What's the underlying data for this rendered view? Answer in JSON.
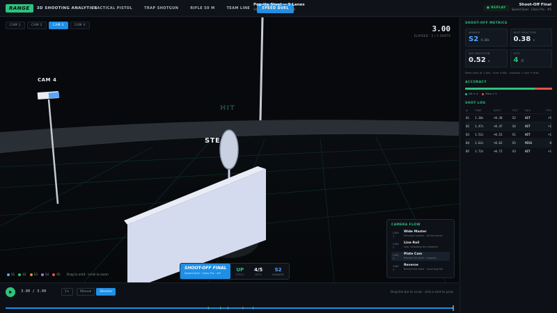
{
  "header": {
    "logo": "RANGE",
    "subtitle": "3D SHOOTING ANALYTICS",
    "tabs": [
      {
        "label": "PRACTICAL PISTOL",
        "active": false
      },
      {
        "label": "TRAP SHOTGUN",
        "active": false
      },
      {
        "label": "RIFLE 50 M",
        "active": false
      },
      {
        "label": "TEAM LINE",
        "active": false
      },
      {
        "label": "SPEED DUEL",
        "active": true
      }
    ],
    "stage_title": "Pop-Up Steel — 5 Lanes",
    "stage_sub": "Shoot-Off · Final · 6mm Steel",
    "replay_label": "● REPLAY",
    "final_title": "Shoot-Off Final",
    "final_sub": "Speed Duel · Class Pro · #5"
  },
  "viewport": {
    "cam_tabs": [
      {
        "label": "CAM 1",
        "active": false
      },
      {
        "label": "CAM 2",
        "active": false
      },
      {
        "label": "CAM 3",
        "active": true
      },
      {
        "label": "CAM 4",
        "active": false
      }
    ],
    "timer": "3.00",
    "timer_sub": "ELAPSED · 5 / 5 SHOTS",
    "cam4_label": "CAM 4",
    "steel_label": "STE",
    "hit_label": "HIT",
    "legend": [
      {
        "label": "S1",
        "color": "#58a6ff"
      },
      {
        "label": "S2",
        "color": "#2ec27e"
      },
      {
        "label": "S3",
        "color": "#d29922"
      },
      {
        "label": "S4",
        "color": "#a371f7"
      },
      {
        "label": "S5",
        "color": "#e5534b"
      }
    ],
    "legend_hint": "Drag to orbit · scroll to zoom",
    "hud": {
      "title": "SHOOT-OFF FINAL",
      "sub": "Speed Duel · Class Pro · #5",
      "cells": [
        {
          "value": "UP",
          "label": "STEEL",
          "style": "green"
        },
        {
          "value": "4/5",
          "label": "HITS",
          "style": ""
        },
        {
          "value": "S2",
          "label": "WINNER",
          "style": "blue"
        }
      ]
    },
    "camera_flow": {
      "title": "CAMERA FLOW",
      "items": [
        {
          "cam": "CAM 1",
          "name": "Wide Master",
          "desc": "Elevated master · all five lanes",
          "active": false
        },
        {
          "cam": "CAM 2",
          "name": "Line Rail",
          "desc": "Low, following the shooters",
          "active": false
        },
        {
          "cam": "CAM 3",
          "name": "Plate Cam",
          "desc": "Beside the steel · impacts",
          "active": true
        },
        {
          "cam": "CAM 4",
          "name": "Reverse",
          "desc": "Behind the steel · incoming fire",
          "active": false
        }
      ]
    }
  },
  "panel": {
    "metrics_title": "SHOOT-OFF METRICS",
    "metrics": [
      {
        "label": "WINNER",
        "value": "S2",
        "unit": "0.38s",
        "style": "blue"
      },
      {
        "label": "BEST REACTION",
        "value": "0.38",
        "unit": "s",
        "style": ""
      },
      {
        "label": "AVG REACTION",
        "value": "0.52",
        "unit": "s",
        "style": ""
      },
      {
        "label": "HITS",
        "value": "4",
        "unit": "/5",
        "style": "green"
      }
    ],
    "metrics_note": "Steel rises at 1.00s · over 0.60s · reaction = rise → shot",
    "accuracy_title": "ACCURACY",
    "accuracy": {
      "hits": 4,
      "misses": 1,
      "hit_label": "Hit × 4",
      "miss_label": "Miss × 1",
      "hit_color": "#2ec27e",
      "miss_color": "#e5534b"
    },
    "log_title": "SHOT LOG",
    "log_columns": [
      "#",
      "TIME",
      "SPLIT",
      "TGT",
      "RES",
      "PTS"
    ],
    "log_rows": [
      {
        "n": "01",
        "time": "1.38s",
        "split": "+0.38",
        "tgt": "S2",
        "res": "HIT",
        "pts": "+5",
        "kind": "hit"
      },
      {
        "n": "02",
        "time": "1.47s",
        "split": "+0.47",
        "tgt": "S4",
        "res": "HIT",
        "pts": "+1",
        "kind": "hit"
      },
      {
        "n": "03",
        "time": "1.52s",
        "split": "+0.52",
        "tgt": "S1",
        "res": "HIT",
        "pts": "+1",
        "kind": "hit"
      },
      {
        "n": "04",
        "time": "1.62s",
        "split": "+0.62",
        "tgt": "S5",
        "res": "MISS",
        "pts": "0",
        "kind": "miss"
      },
      {
        "n": "05",
        "time": "1.72s",
        "split": "+0.72",
        "tgt": "S3",
        "res": "HIT",
        "pts": "+1",
        "kind": "hit"
      }
    ]
  },
  "playback": {
    "time": "3.00 / 3.00",
    "speed": "1×",
    "modes": [
      {
        "label": "Manual",
        "active": false
      },
      {
        "label": "Director",
        "active": true
      }
    ],
    "hint": "Drag the bar to scrub · click a shot to jump",
    "progress": 1.0,
    "shot_marks": [
      0.453,
      0.48,
      0.497,
      0.53,
      0.553
    ],
    "accent": "#1e8fe6"
  }
}
